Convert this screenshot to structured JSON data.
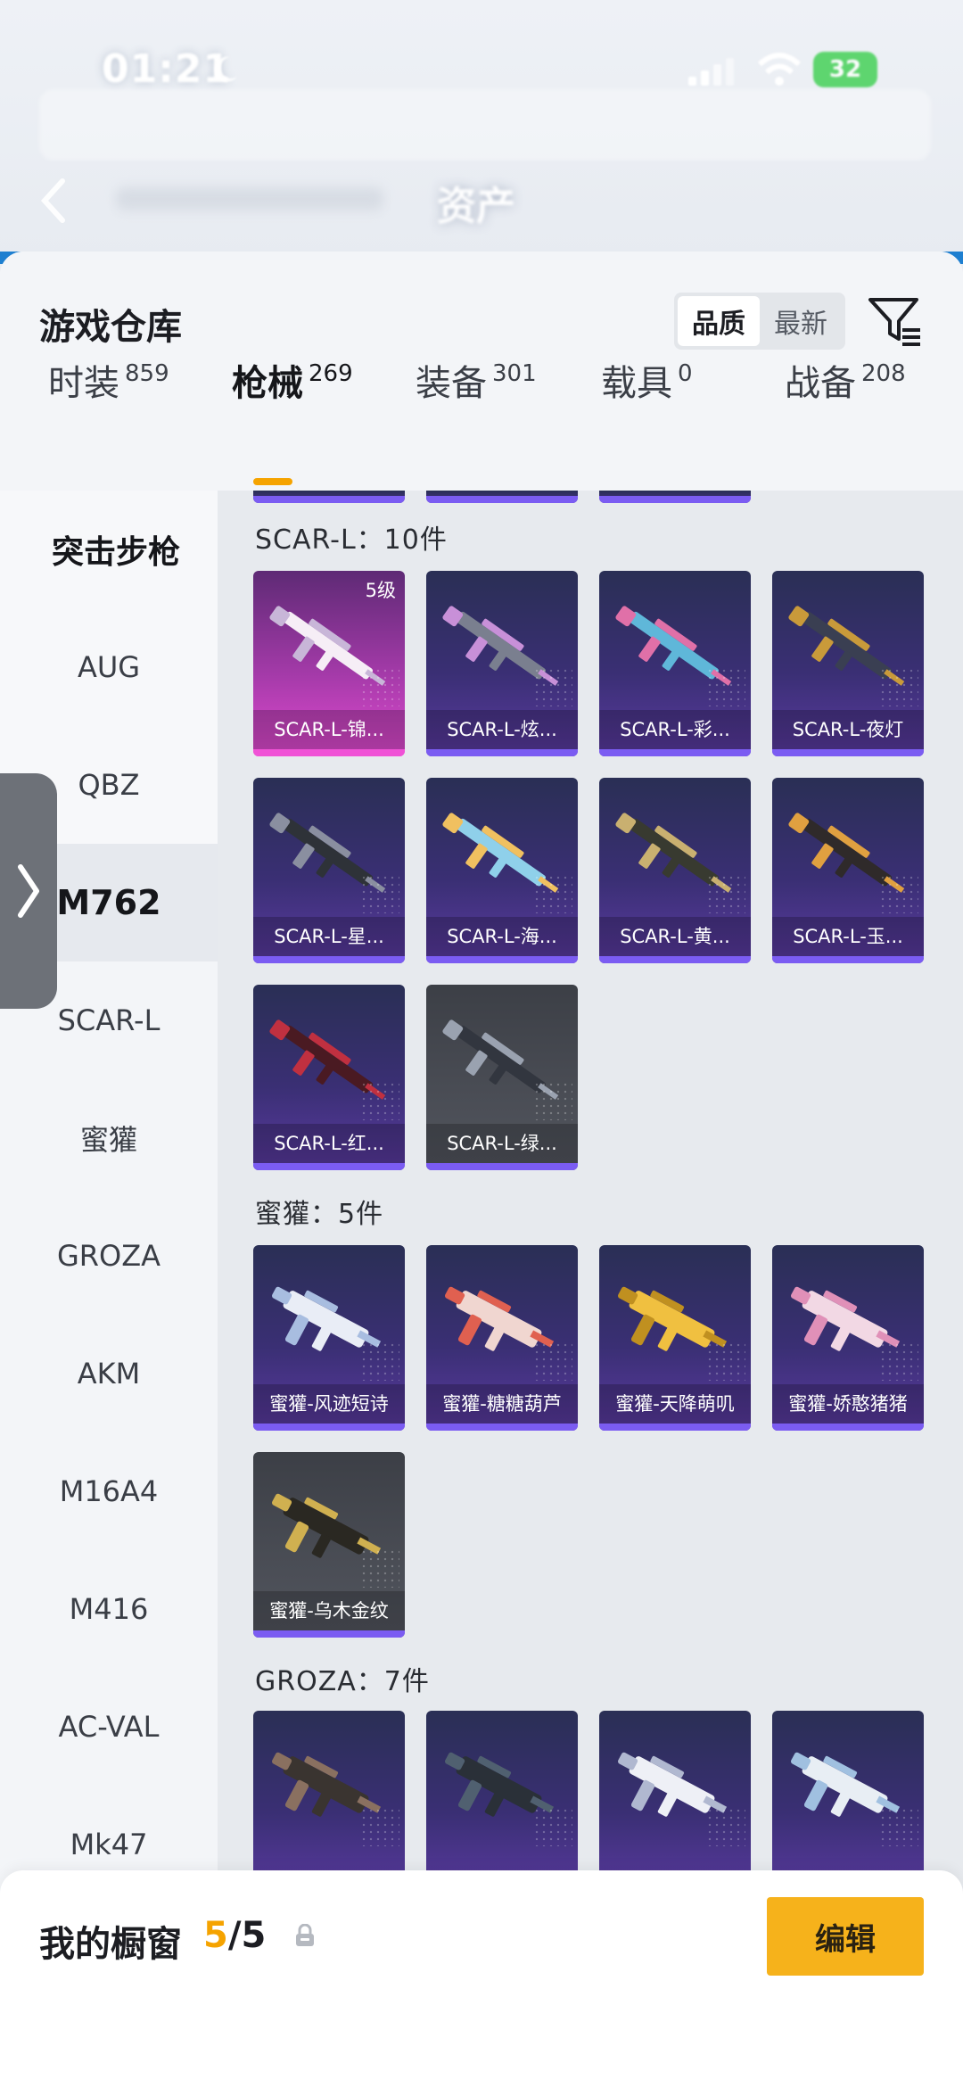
{
  "status": {
    "time": "01:21",
    "battery": "32"
  },
  "background": {
    "title": "资产"
  },
  "sheet": {
    "title": "游戏仓库",
    "sort": {
      "options": [
        "品质",
        "最新"
      ],
      "active": "品质"
    }
  },
  "tabs": [
    {
      "label": "时装",
      "count": "859"
    },
    {
      "label": "枪械",
      "count": "269",
      "active": true
    },
    {
      "label": "装备",
      "count": "301"
    },
    {
      "label": "载具",
      "count": "0"
    },
    {
      "label": "战备",
      "count": "208"
    }
  ],
  "categories": [
    "突击步枪",
    "AUG",
    "QBZ",
    "M762",
    "SCAR-L",
    "蜜獾",
    "GROZA",
    "AKM",
    "M16A4",
    "M416",
    "AC-VAL",
    "Mk47"
  ],
  "active_category": "M762",
  "groups": [
    {
      "title": "SCAR-L：10件",
      "items": [
        {
          "name": "SCAR-L-锦...",
          "rarity": "legendary",
          "level": "5级"
        },
        {
          "name": "SCAR-L-炫...",
          "rarity": "epic"
        },
        {
          "name": "SCAR-L-彩...",
          "rarity": "epic"
        },
        {
          "name": "SCAR-L-夜灯",
          "rarity": "epic"
        },
        {
          "name": "SCAR-L-星...",
          "rarity": "epic"
        },
        {
          "name": "SCAR-L-海...",
          "rarity": "epic"
        },
        {
          "name": "SCAR-L-黄...",
          "rarity": "epic"
        },
        {
          "name": "SCAR-L-玉...",
          "rarity": "epic"
        },
        {
          "name": "SCAR-L-红...",
          "rarity": "epic"
        },
        {
          "name": "SCAR-L-绿...",
          "rarity": "rare"
        }
      ]
    },
    {
      "title": "蜜獾：5件",
      "items": [
        {
          "name": "蜜獾-风迹短诗",
          "rarity": "epic"
        },
        {
          "name": "蜜獾-糖糖葫芦",
          "rarity": "epic"
        },
        {
          "name": "蜜獾-天降萌叽",
          "rarity": "epic"
        },
        {
          "name": "蜜獾-娇憨猪猪",
          "rarity": "epic"
        },
        {
          "name": "蜜獾-乌木金纹",
          "rarity": "rare"
        }
      ]
    },
    {
      "title": "GROZA：7件",
      "items": [
        {
          "name": "",
          "rarity": "epic"
        },
        {
          "name": "",
          "rarity": "epic"
        },
        {
          "name": "",
          "rarity": "epic"
        },
        {
          "name": "",
          "rarity": "epic"
        }
      ]
    }
  ],
  "showcase": {
    "label": "我的橱窗",
    "current": "5",
    "total": "/5",
    "edit_label": "编辑"
  },
  "colors": {
    "accent": "#f5a300",
    "button": "#f6b21b",
    "epic_bar": "#7b5cf2",
    "legendary_bar": "#f052d6"
  }
}
